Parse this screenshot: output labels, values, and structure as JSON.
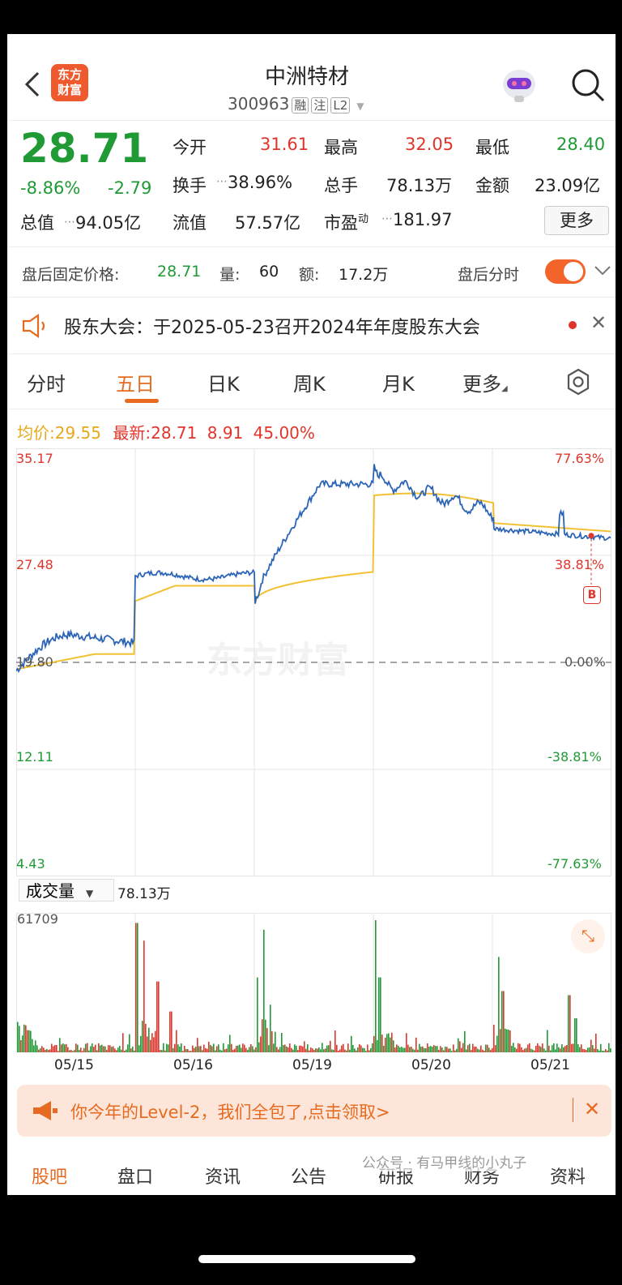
{
  "header": {
    "title": "中洲特材",
    "code": "300963",
    "tags": [
      "融",
      "注",
      "L2"
    ],
    "logo_text": "东方\n财富"
  },
  "quote": {
    "price": "28.71",
    "change_pct": "-8.86%",
    "change": "-2.79",
    "fields": [
      {
        "label": "今开",
        "value": "31.61"
      },
      {
        "label": "最高",
        "value": "32.05"
      },
      {
        "label": "最低",
        "value": "28.40"
      },
      {
        "label": "换手",
        "value": "38.96%"
      },
      {
        "label": "总手",
        "value": "78.13万"
      },
      {
        "label": "金额",
        "value": "23.09亿"
      },
      {
        "label": "总值",
        "value": "94.05亿"
      },
      {
        "label": "流值",
        "value": "57.57亿"
      },
      {
        "label": "市盈",
        "label_sup": "动",
        "value": "181.97"
      }
    ],
    "more_label": "更多"
  },
  "after_hours": {
    "price_label": "盘后固定价格:",
    "price": "28.71",
    "vol_label": "量:",
    "vol": "60",
    "amt_label": "额:",
    "amt": "17.2万",
    "timeshare_label": "盘后分时"
  },
  "notice": {
    "text": "股东大会：于2025-05-23召开2024年年度股东大会"
  },
  "tabs": [
    "分时",
    "五日",
    "日K",
    "周K",
    "月K",
    "更多"
  ],
  "active_tab": "五日",
  "price_chart": {
    "avg_label": "均价:",
    "avg": "29.55",
    "latest_label": "最新:",
    "latest": "28.71",
    "change": "8.91",
    "change_pct": "45.00%",
    "left_ticks": [
      "35.17",
      "27.48",
      "19.80",
      "12.11",
      "4.43"
    ],
    "right_ticks": [
      "77.63%",
      "38.81%",
      "0.00%",
      "-38.81%",
      "-77.63%"
    ],
    "watermark": "东方财富",
    "marker": "B"
  },
  "volume": {
    "selector": "成交量",
    "total": "78.13万",
    "max_label": "61709"
  },
  "dates": [
    "05/15",
    "05/16",
    "05/19",
    "05/20",
    "05/21"
  ],
  "banner": {
    "text": "你今年的Level-2，我们全包了,点击领取>"
  },
  "bottom_tabs": [
    "股吧",
    "盘口",
    "资讯",
    "公告",
    "研报",
    "财务",
    "资料"
  ],
  "wechat_watermark": "公众号 · 有马甲线的小丸子",
  "colors": {
    "up": "#e0352b",
    "down": "#1f9a35",
    "price_line": "#2c64b7",
    "avg_line": "#f2c033",
    "accent": "#e66a1f"
  },
  "chart_data": {
    "type": "line",
    "x": [
      "05/15",
      "05/16",
      "05/19",
      "05/20",
      "05/21"
    ],
    "series": [
      {
        "name": "最新",
        "values": [
          20.5,
          26.0,
          32.5,
          33.5,
          28.71
        ]
      },
      {
        "name": "均价",
        "values": [
          20.3,
          25.2,
          26.3,
          31.4,
          29.55
        ]
      }
    ],
    "ylim": [
      4.43,
      35.17
    ]
  }
}
